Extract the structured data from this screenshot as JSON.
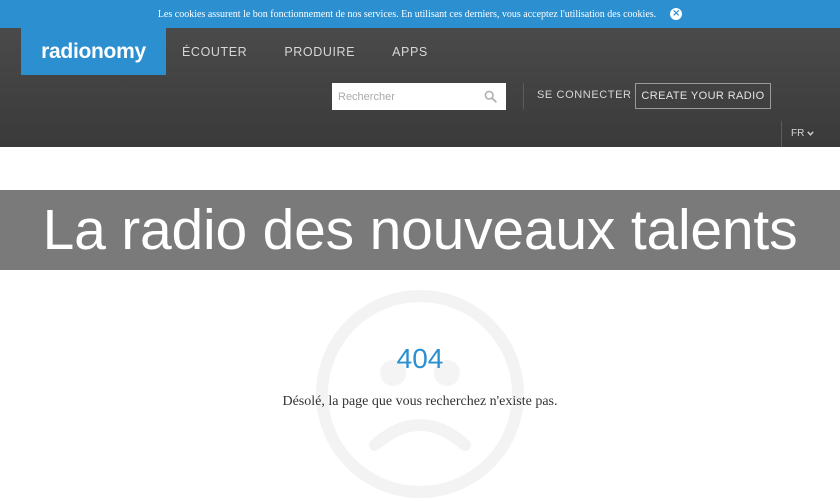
{
  "cookie_bar": {
    "text": "Les cookies assurent le bon fonctionnement de nos services. En utilisant ces derniers, vous acceptez l'utilisation des cookies.",
    "close_glyph": "×"
  },
  "header": {
    "logo": "radionomy",
    "nav": [
      {
        "label": "ÉCOUTER"
      },
      {
        "label": "PRODUIRE"
      },
      {
        "label": "APPS"
      }
    ],
    "search": {
      "placeholder": "Rechercher",
      "value": ""
    },
    "connect_label": "SE CONNECTER",
    "create_label": "CREATE YOUR RADIO",
    "language": "FR"
  },
  "banner": {
    "text": "La radio des nouveaux talents"
  },
  "error": {
    "code": "404",
    "message": "Désolé, la page que vous recherchez n'existe pas."
  },
  "icons": {
    "search": "search-icon",
    "close": "close-icon",
    "chevron": "chevron-down-icon",
    "watermark": "sad-face-icon"
  },
  "colors": {
    "brand": "#2b8fd0",
    "header_bg": "#404040",
    "banner_bg": "#7a7a7a"
  }
}
